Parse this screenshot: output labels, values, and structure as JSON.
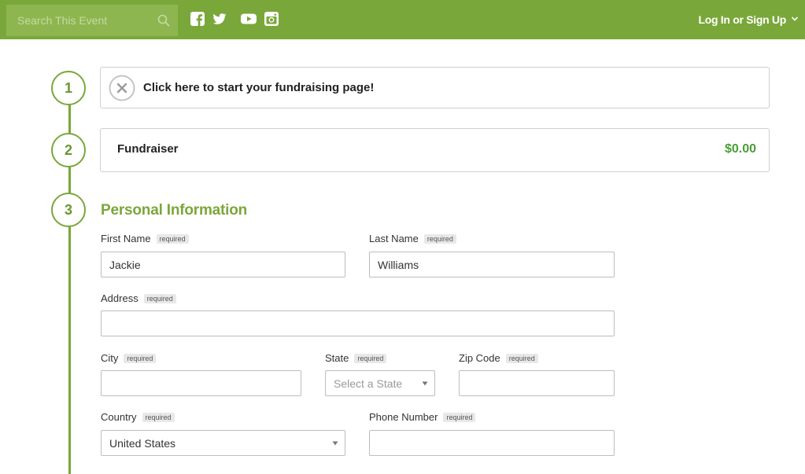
{
  "header": {
    "search_placeholder": "Search This Event",
    "search_icon": "search-icon",
    "social_icons": [
      "facebook-icon",
      "twitter-icon",
      "youtube-icon",
      "instagram-icon"
    ],
    "login_label": "Log In or Sign Up",
    "bar_color": "#7aa73a"
  },
  "steps": [
    "1",
    "2",
    "3"
  ],
  "start_card": {
    "text": "Click here to start your fundraising page!",
    "icon": "close-circle-icon"
  },
  "fundraiser_card": {
    "label": "Fundraiser",
    "amount": "$0.00",
    "amount_color": "#4a9e3a"
  },
  "personal_info": {
    "title": "Personal Information",
    "required_tag": "required",
    "fields": {
      "first_name": {
        "label": "First Name",
        "value": "Jackie"
      },
      "last_name": {
        "label": "Last Name",
        "value": "Williams"
      },
      "address": {
        "label": "Address",
        "value": ""
      },
      "city": {
        "label": "City",
        "value": ""
      },
      "state": {
        "label": "State",
        "placeholder": "Select a State"
      },
      "zip": {
        "label": "Zip Code",
        "value": ""
      },
      "country": {
        "label": "Country",
        "value": "United States"
      },
      "phone": {
        "label": "Phone Number",
        "value": ""
      }
    }
  }
}
